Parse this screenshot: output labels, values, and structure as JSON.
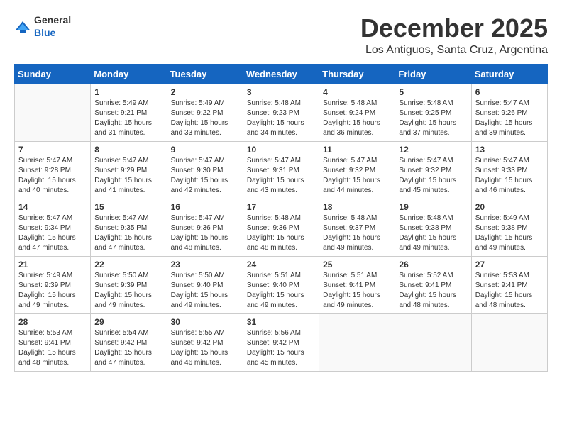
{
  "logo": {
    "general": "General",
    "blue": "Blue"
  },
  "title": "December 2025",
  "location": "Los Antiguos, Santa Cruz, Argentina",
  "weekdays": [
    "Sunday",
    "Monday",
    "Tuesday",
    "Wednesday",
    "Thursday",
    "Friday",
    "Saturday"
  ],
  "weeks": [
    [
      {
        "day": "",
        "info": ""
      },
      {
        "day": "1",
        "info": "Sunrise: 5:49 AM\nSunset: 9:21 PM\nDaylight: 15 hours\nand 31 minutes."
      },
      {
        "day": "2",
        "info": "Sunrise: 5:49 AM\nSunset: 9:22 PM\nDaylight: 15 hours\nand 33 minutes."
      },
      {
        "day": "3",
        "info": "Sunrise: 5:48 AM\nSunset: 9:23 PM\nDaylight: 15 hours\nand 34 minutes."
      },
      {
        "day": "4",
        "info": "Sunrise: 5:48 AM\nSunset: 9:24 PM\nDaylight: 15 hours\nand 36 minutes."
      },
      {
        "day": "5",
        "info": "Sunrise: 5:48 AM\nSunset: 9:25 PM\nDaylight: 15 hours\nand 37 minutes."
      },
      {
        "day": "6",
        "info": "Sunrise: 5:47 AM\nSunset: 9:26 PM\nDaylight: 15 hours\nand 39 minutes."
      }
    ],
    [
      {
        "day": "7",
        "info": "Sunrise: 5:47 AM\nSunset: 9:28 PM\nDaylight: 15 hours\nand 40 minutes."
      },
      {
        "day": "8",
        "info": "Sunrise: 5:47 AM\nSunset: 9:29 PM\nDaylight: 15 hours\nand 41 minutes."
      },
      {
        "day": "9",
        "info": "Sunrise: 5:47 AM\nSunset: 9:30 PM\nDaylight: 15 hours\nand 42 minutes."
      },
      {
        "day": "10",
        "info": "Sunrise: 5:47 AM\nSunset: 9:31 PM\nDaylight: 15 hours\nand 43 minutes."
      },
      {
        "day": "11",
        "info": "Sunrise: 5:47 AM\nSunset: 9:32 PM\nDaylight: 15 hours\nand 44 minutes."
      },
      {
        "day": "12",
        "info": "Sunrise: 5:47 AM\nSunset: 9:32 PM\nDaylight: 15 hours\nand 45 minutes."
      },
      {
        "day": "13",
        "info": "Sunrise: 5:47 AM\nSunset: 9:33 PM\nDaylight: 15 hours\nand 46 minutes."
      }
    ],
    [
      {
        "day": "14",
        "info": "Sunrise: 5:47 AM\nSunset: 9:34 PM\nDaylight: 15 hours\nand 47 minutes."
      },
      {
        "day": "15",
        "info": "Sunrise: 5:47 AM\nSunset: 9:35 PM\nDaylight: 15 hours\nand 47 minutes."
      },
      {
        "day": "16",
        "info": "Sunrise: 5:47 AM\nSunset: 9:36 PM\nDaylight: 15 hours\nand 48 minutes."
      },
      {
        "day": "17",
        "info": "Sunrise: 5:48 AM\nSunset: 9:36 PM\nDaylight: 15 hours\nand 48 minutes."
      },
      {
        "day": "18",
        "info": "Sunrise: 5:48 AM\nSunset: 9:37 PM\nDaylight: 15 hours\nand 49 minutes."
      },
      {
        "day": "19",
        "info": "Sunrise: 5:48 AM\nSunset: 9:38 PM\nDaylight: 15 hours\nand 49 minutes."
      },
      {
        "day": "20",
        "info": "Sunrise: 5:49 AM\nSunset: 9:38 PM\nDaylight: 15 hours\nand 49 minutes."
      }
    ],
    [
      {
        "day": "21",
        "info": "Sunrise: 5:49 AM\nSunset: 9:39 PM\nDaylight: 15 hours\nand 49 minutes."
      },
      {
        "day": "22",
        "info": "Sunrise: 5:50 AM\nSunset: 9:39 PM\nDaylight: 15 hours\nand 49 minutes."
      },
      {
        "day": "23",
        "info": "Sunrise: 5:50 AM\nSunset: 9:40 PM\nDaylight: 15 hours\nand 49 minutes."
      },
      {
        "day": "24",
        "info": "Sunrise: 5:51 AM\nSunset: 9:40 PM\nDaylight: 15 hours\nand 49 minutes."
      },
      {
        "day": "25",
        "info": "Sunrise: 5:51 AM\nSunset: 9:41 PM\nDaylight: 15 hours\nand 49 minutes."
      },
      {
        "day": "26",
        "info": "Sunrise: 5:52 AM\nSunset: 9:41 PM\nDaylight: 15 hours\nand 48 minutes."
      },
      {
        "day": "27",
        "info": "Sunrise: 5:53 AM\nSunset: 9:41 PM\nDaylight: 15 hours\nand 48 minutes."
      }
    ],
    [
      {
        "day": "28",
        "info": "Sunrise: 5:53 AM\nSunset: 9:41 PM\nDaylight: 15 hours\nand 48 minutes."
      },
      {
        "day": "29",
        "info": "Sunrise: 5:54 AM\nSunset: 9:42 PM\nDaylight: 15 hours\nand 47 minutes."
      },
      {
        "day": "30",
        "info": "Sunrise: 5:55 AM\nSunset: 9:42 PM\nDaylight: 15 hours\nand 46 minutes."
      },
      {
        "day": "31",
        "info": "Sunrise: 5:56 AM\nSunset: 9:42 PM\nDaylight: 15 hours\nand 45 minutes."
      },
      {
        "day": "",
        "info": ""
      },
      {
        "day": "",
        "info": ""
      },
      {
        "day": "",
        "info": ""
      }
    ]
  ]
}
